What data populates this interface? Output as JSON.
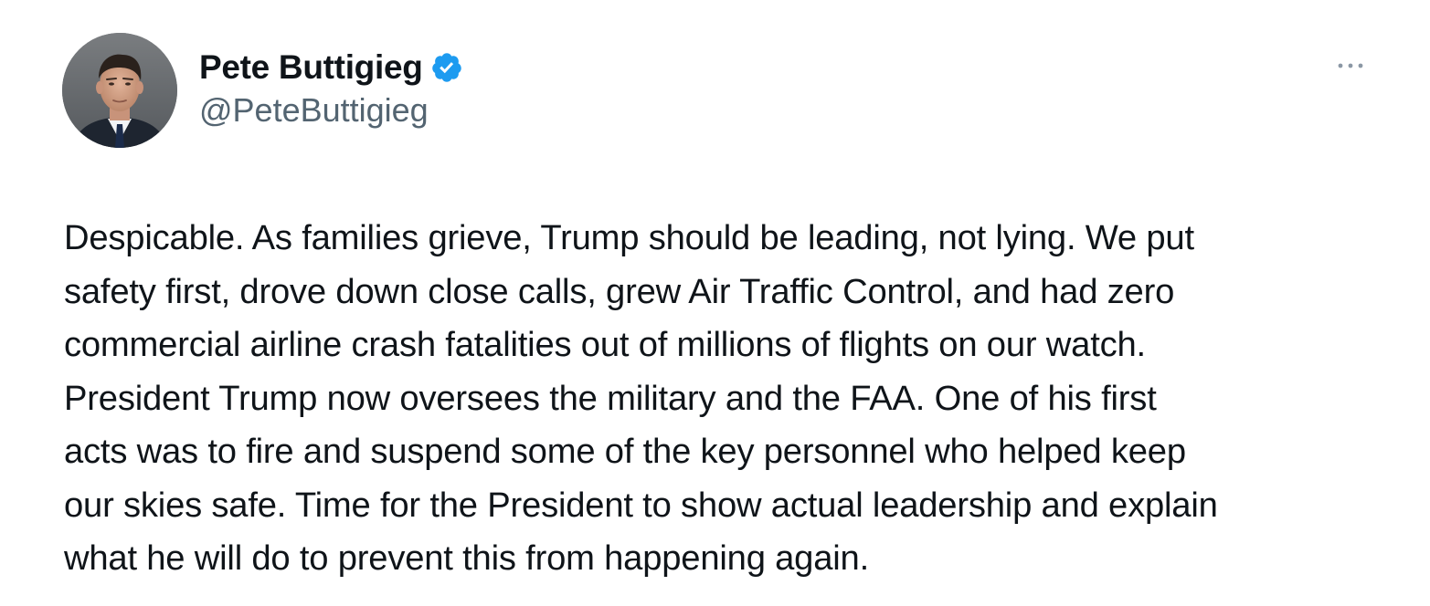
{
  "author": {
    "display_name": "Pete Buttigieg",
    "handle": "@PeteButtigieg",
    "avatar_icon": "profile-photo",
    "verified_icon": "verified-badge-icon",
    "verified_color": "#1d9bf0"
  },
  "menu": {
    "icon": "more-options-icon"
  },
  "tweet": {
    "text": "Despicable. As families grieve, Trump should be leading, not lying. We put\nsafety first, drove down close calls, grew Air Traffic Control, and had zero\ncommercial airline crash fatalities out of millions of flights on our watch.\nPresident Trump now oversees the military and the FAA. One of his first\nacts was to fire and suspend some of the key personnel who helped keep\nour skies safe. Time for the President to show actual leadership and explain\nwhat he will do to prevent this from happening again."
  },
  "colors": {
    "text_primary": "#0f1419",
    "text_secondary": "#536471",
    "background": "#ffffff"
  }
}
